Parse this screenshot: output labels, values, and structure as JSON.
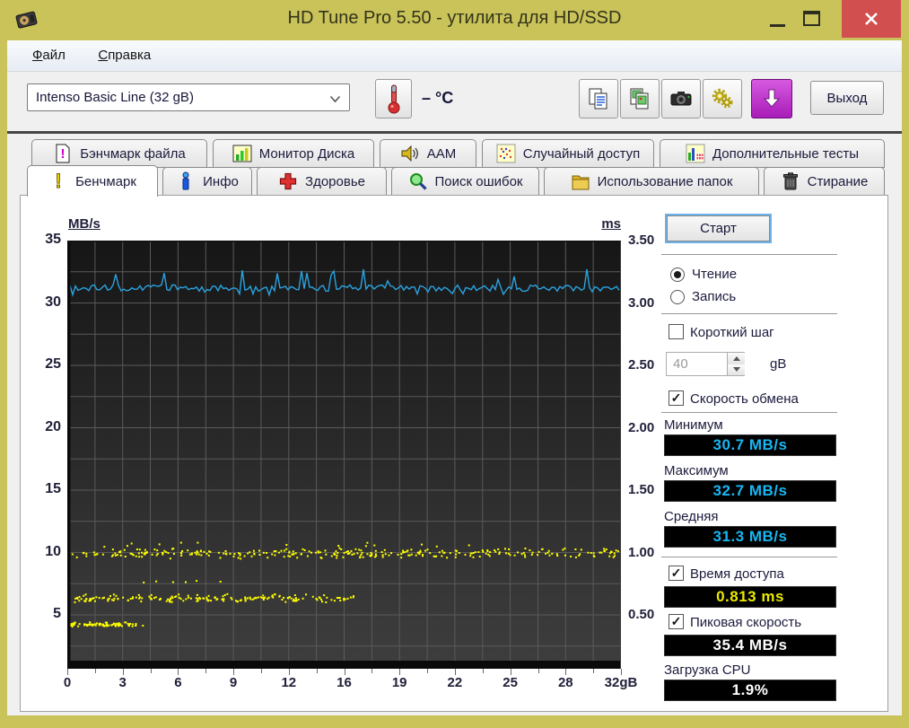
{
  "window": {
    "title": "HD Tune Pro 5.50 - утилита для HD/SSD",
    "controls": {
      "minimize_icon": "minimize-icon",
      "maximize_icon": "maximize-icon",
      "close_icon": "close-icon"
    }
  },
  "menu": {
    "items": [
      {
        "label": "Файл"
      },
      {
        "label": "Справка"
      }
    ]
  },
  "toolbar": {
    "device_select": {
      "value": "Intenso Basic Line (32 gB)"
    },
    "thermometer_icon": "thermometer-icon",
    "temperature": "– °C",
    "buttons": [
      {
        "icon": "copy-text-icon"
      },
      {
        "icon": "copy-image-icon"
      },
      {
        "icon": "camera-icon"
      },
      {
        "icon": "gears-icon"
      },
      {
        "icon": "save-arrow-icon"
      }
    ],
    "exit_label": "Выход"
  },
  "tabs_row1": [
    {
      "icon": "file-benchmark-icon",
      "label": "Бэнчмарк файла"
    },
    {
      "icon": "disk-monitor-icon",
      "label": "Монитор Диска"
    },
    {
      "icon": "speaker-icon",
      "label": "AAM"
    },
    {
      "icon": "random-access-icon",
      "label": "Случайный доступ"
    },
    {
      "icon": "extra-tests-icon",
      "label": "Дополнительные тесты"
    }
  ],
  "tabs_row2": [
    {
      "icon": "benchmark-icon",
      "label": "Бенчмарк",
      "active": true
    },
    {
      "icon": "info-icon",
      "label": "Инфо",
      "active": false
    },
    {
      "icon": "health-icon",
      "label": "Здоровье",
      "active": false
    },
    {
      "icon": "error-scan-icon",
      "label": "Поиск ошибок",
      "active": false
    },
    {
      "icon": "folder-usage-icon",
      "label": "Использование папок",
      "active": false
    },
    {
      "icon": "erase-icon",
      "label": "Стирание",
      "active": false
    }
  ],
  "chart_data": {
    "type": "line+scatter",
    "y_left": {
      "label": "MB/s",
      "ticks": [
        "35",
        "30",
        "25",
        "20",
        "15",
        "10",
        "5"
      ],
      "max": 35,
      "tick_step": 5
    },
    "y_right": {
      "label": "ms",
      "ticks": [
        "3.50",
        "3.00",
        "2.50",
        "2.00",
        "1.50",
        "1.00",
        "0.50"
      ]
    },
    "x": {
      "ticks": [
        "0",
        "3",
        "6",
        "9",
        "12",
        "16",
        "19",
        "22",
        "25",
        "28",
        "32gB"
      ],
      "min": 0,
      "max": 32
    },
    "grid": {
      "h_step_mbs": 2.5,
      "v_divisions": 20,
      "color": "#5a5a5a"
    },
    "plot_bg_top": "#161616",
    "plot_bg_bottom": "#3e3e3e",
    "series": [
      {
        "name": "read-speed",
        "type": "line",
        "color": "#2aa3e0",
        "unit": "MB/s",
        "avg": 31.3,
        "min": 30.7,
        "max": 32.7
      },
      {
        "name": "access-time",
        "type": "scatter",
        "color": "#ffff00",
        "unit": "ms",
        "bands": [
          {
            "ms": 1.0,
            "from_gb": 0.2,
            "to_gb": 31.8,
            "count": 300,
            "jitter": 0.045
          },
          {
            "ms": 0.64,
            "from_gb": 0.2,
            "to_gb": 16.5,
            "count": 180,
            "jitter": 0.035
          },
          {
            "ms": 0.43,
            "from_gb": 0.1,
            "to_gb": 4.4,
            "count": 80,
            "jitter": 0.02
          },
          {
            "ms": 1.07,
            "from_gb": 1.0,
            "to_gb": 28.0,
            "count": 14,
            "jitter": 0.03
          },
          {
            "ms": 0.77,
            "from_gb": 4.0,
            "to_gb": 11.0,
            "count": 6,
            "jitter": 0.02
          }
        ]
      }
    ]
  },
  "controls": {
    "start_label": "Старт",
    "read_label": "Чтение",
    "read_selected": true,
    "write_label": "Запись",
    "write_selected": false,
    "short_stride_label": "Короткий шаг",
    "short_stride_checked": false,
    "stride_value": "40",
    "stride_unit": "gB",
    "transfer_label": "Скорость обмена",
    "transfer_checked": true,
    "min_label": "Минимум",
    "min_value": "30.7 MB/s",
    "max_label": "Максимум",
    "max_value": "32.7 MB/s",
    "avg_label": "Средняя",
    "avg_value": "31.3 MB/s",
    "access_label": "Время доступа",
    "access_checked": true,
    "access_value": "0.813 ms",
    "burst_label": "Пиковая скорость",
    "burst_checked": true,
    "burst_value": "35.4 MB/s",
    "cpu_label": "Загрузка CPU",
    "cpu_value": "1.9%"
  }
}
